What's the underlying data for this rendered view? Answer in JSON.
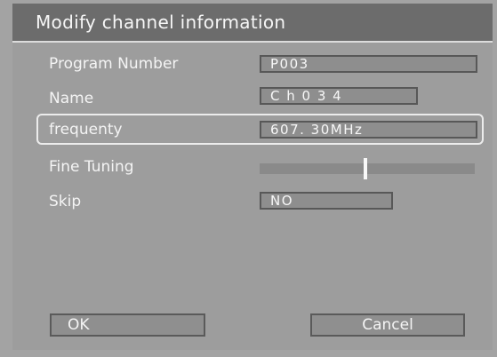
{
  "dialog": {
    "title": "Modify channel information"
  },
  "fields": {
    "program_number": {
      "label": "Program Number",
      "value": "P003"
    },
    "name": {
      "label": "Name",
      "value": "C h 0 3 4"
    },
    "frequency": {
      "label": "frequenty",
      "value": "607. 30MHz"
    },
    "fine_tuning": {
      "label": "Fine Tuning",
      "level": 0.49
    },
    "skip": {
      "label": "Skip",
      "value": "NO"
    }
  },
  "buttons": {
    "ok_label": "OK",
    "cancel_label": "Cancel"
  },
  "colors": {
    "title_bar": "#6c6c6c",
    "dialog_bg": "#9d9d9d",
    "highlight_border": "#ececec"
  }
}
